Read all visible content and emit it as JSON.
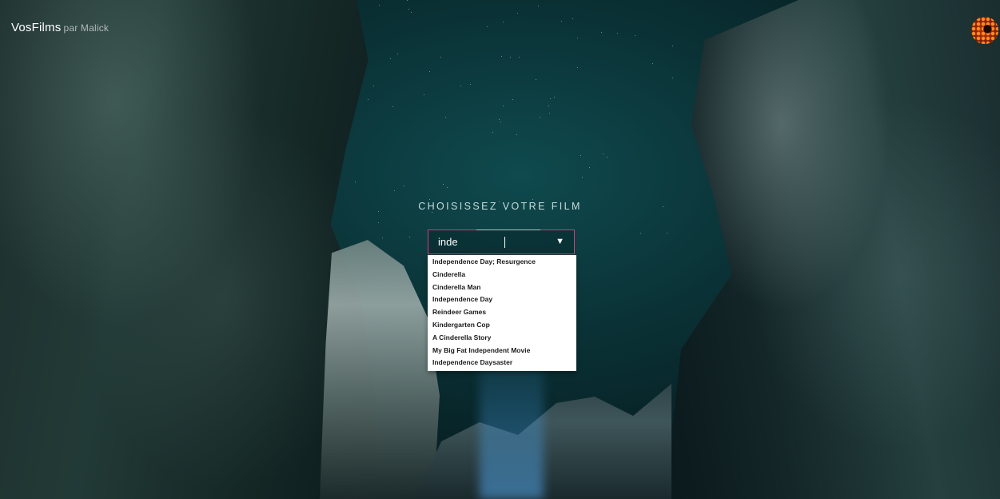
{
  "header": {
    "brand": "VosFilms",
    "byline": "par Malick",
    "logo_icon": "sunburst-logo-icon"
  },
  "picker": {
    "title": "CHOISISSEZ VOTRE FILM",
    "input_value": "inde",
    "arrow_icon": "triangle-down-icon",
    "accent_color": "#c8417a",
    "suggestions": [
      "Independence Day; Resurgence",
      "Cinderella",
      "Cinderella Man",
      "Independence Day",
      "Reindeer Games",
      "Kindergarten Cop",
      "A Cinderella Story",
      "My Big Fat Independent Movie",
      "Independence Daysaster"
    ]
  }
}
